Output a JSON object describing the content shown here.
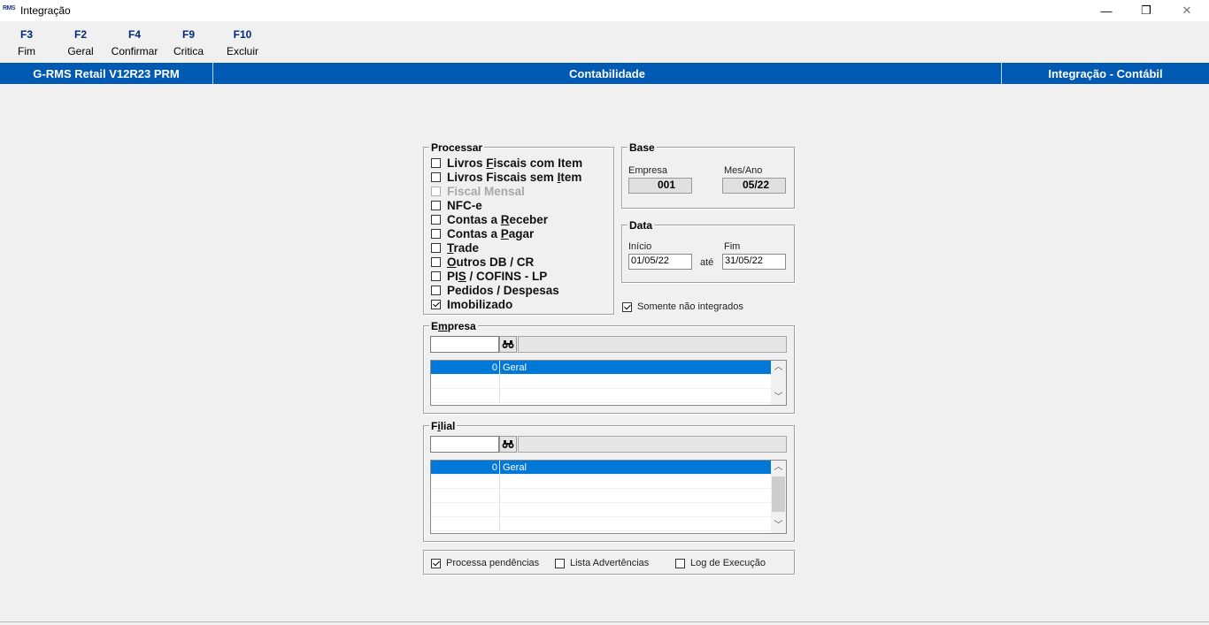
{
  "window": {
    "icon_text": "RMS",
    "title": "Integração",
    "minimize": "—",
    "restore": "❐",
    "close": "✕"
  },
  "toolbar": [
    {
      "key": "F3",
      "label": "Fim"
    },
    {
      "key": "F2",
      "label": "Geral"
    },
    {
      "key": "F4",
      "label": "Confirmar"
    },
    {
      "key": "F9",
      "label": "Critica"
    },
    {
      "key": "F10",
      "label": "Excluir"
    }
  ],
  "header": {
    "system": "G-RMS Retail V12R23 PRM",
    "module": "Contabilidade",
    "screen": "Integração - Contábil"
  },
  "processar": {
    "title": "Processar",
    "items": [
      {
        "pre": "Livros ",
        "u": "F",
        "post": "iscais com Item",
        "checked": false,
        "disabled": false
      },
      {
        "pre": "Livros Fiscais sem ",
        "u": "I",
        "post": "tem",
        "checked": false,
        "disabled": false
      },
      {
        "pre": "Fiscal Mensal",
        "u": "",
        "post": "",
        "checked": false,
        "disabled": true
      },
      {
        "pre": "NFC-e",
        "u": "",
        "post": "",
        "checked": false,
        "disabled": false
      },
      {
        "pre": "Contas a ",
        "u": "R",
        "post": "eceber",
        "checked": false,
        "disabled": false
      },
      {
        "pre": "Contas a ",
        "u": "P",
        "post": "agar",
        "checked": false,
        "disabled": false
      },
      {
        "pre": "",
        "u": "T",
        "post": "rade",
        "checked": false,
        "disabled": false
      },
      {
        "pre": "",
        "u": "O",
        "post": "utros DB / CR",
        "checked": false,
        "disabled": false
      },
      {
        "pre": "PI",
        "u": "S",
        "post": " / COFINS - LP",
        "checked": false,
        "disabled": false
      },
      {
        "pre": "Pedidos / Despesas",
        "u": "",
        "post": "",
        "checked": false,
        "disabled": false
      },
      {
        "pre": "Imobilizado",
        "u": "",
        "post": "",
        "checked": true,
        "disabled": false
      }
    ]
  },
  "base": {
    "title": "Base",
    "empresa_label": "Empresa",
    "empresa_value": "001",
    "mesano_label": "Mes/Ano",
    "mesano_value": "05/22"
  },
  "data": {
    "title": "Data",
    "inicio_label": "Início",
    "inicio_value": "01/05/22",
    "ate_label": "até",
    "fim_label": "Fim",
    "fim_value": "31/05/22"
  },
  "somente": {
    "label": "Somente não integrados",
    "checked": true
  },
  "empresa": {
    "title_pre": "E",
    "title_u": "m",
    "title_post": "presa",
    "input": "",
    "description": "",
    "rows": [
      {
        "code": "0",
        "name": "Geral"
      }
    ]
  },
  "filial": {
    "title_pre": "F",
    "title_u": "i",
    "title_post": "lial",
    "input": "",
    "description": "",
    "rows": [
      {
        "code": "0",
        "name": "Geral"
      }
    ]
  },
  "options": [
    {
      "label": "Processa pendências",
      "checked": true
    },
    {
      "label": "Lista Advertências",
      "checked": false
    },
    {
      "label": "Log de Execução",
      "checked": false
    }
  ],
  "colors": {
    "header_blue": "#0059b3",
    "selection_blue": "#0078d7",
    "fkey_blue": "#00287a"
  }
}
